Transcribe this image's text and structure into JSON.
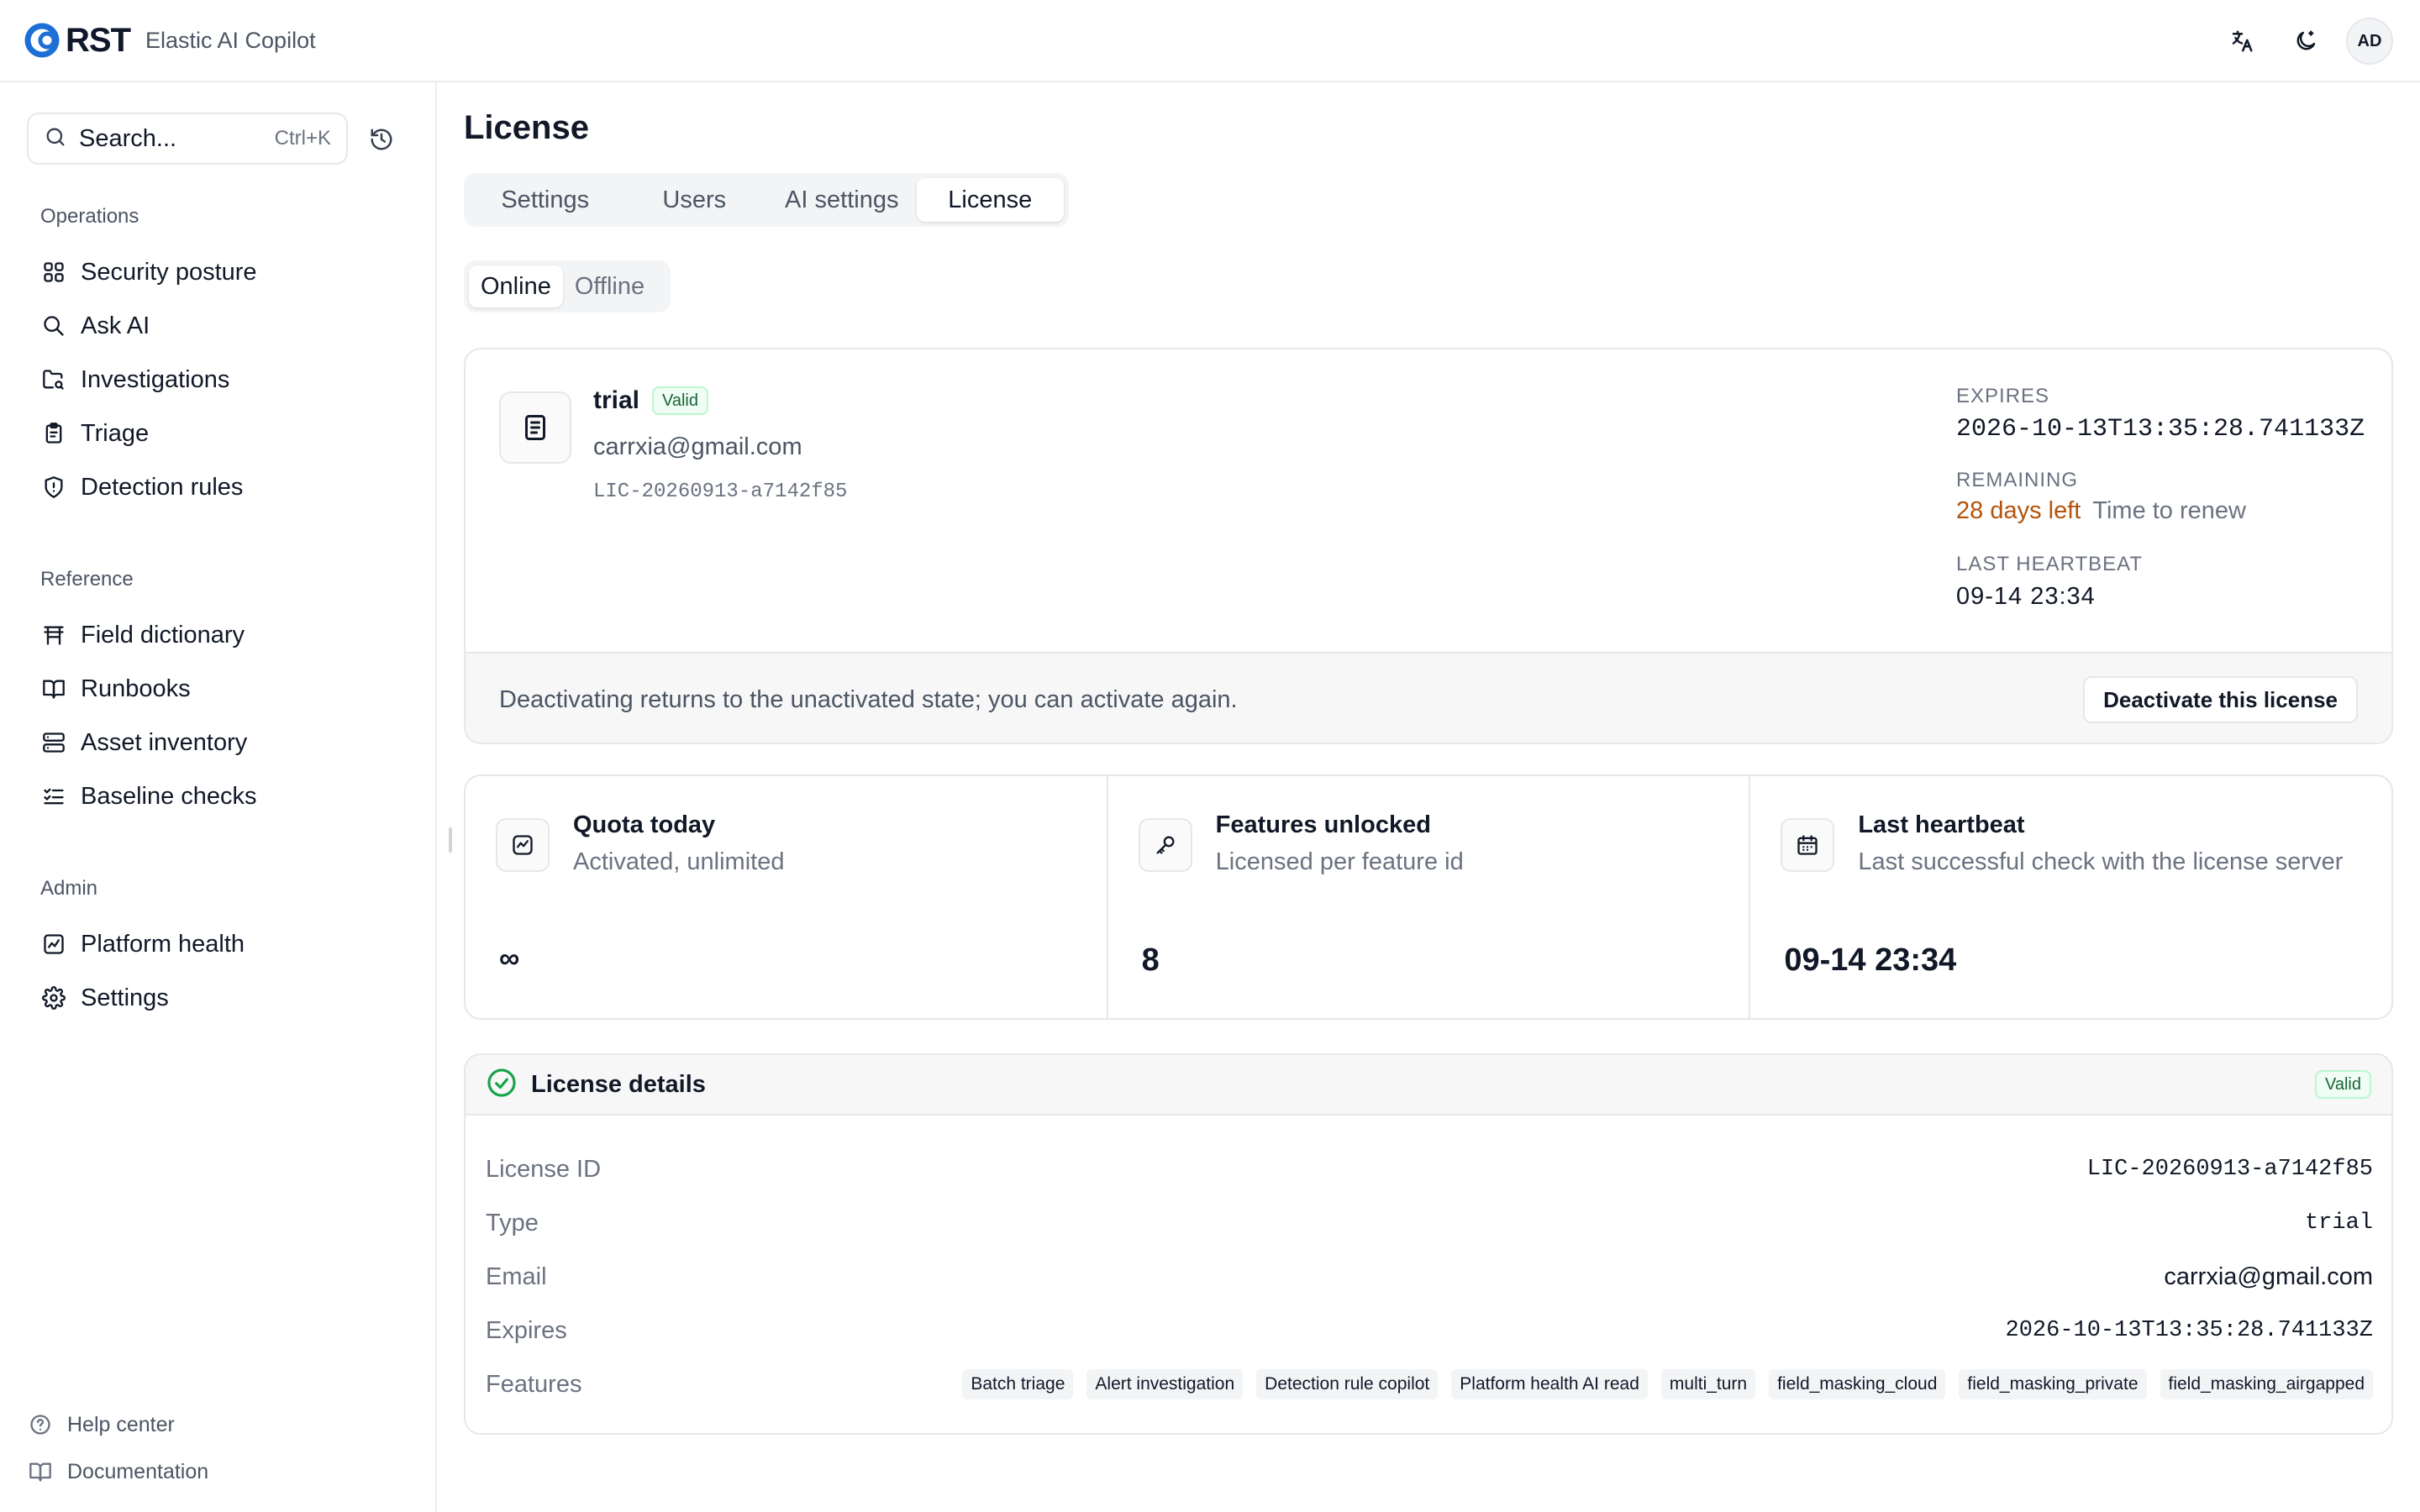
{
  "app": {
    "brand": "RST",
    "subtitle": "Elastic AI Copilot"
  },
  "header": {
    "avatar_initials": "AD",
    "icons": [
      "translate-icon",
      "theme-toggle-icon"
    ]
  },
  "sidebar": {
    "search": {
      "placeholder": "Search...",
      "shortcut": "Ctrl+K"
    },
    "sections": [
      {
        "label": "Operations",
        "items": [
          {
            "label": "Security posture",
            "icon": "grid-icon"
          },
          {
            "label": "Ask AI",
            "icon": "search-icon"
          },
          {
            "label": "Investigations",
            "icon": "folder-search-icon"
          },
          {
            "label": "Triage",
            "icon": "clipboard-icon"
          },
          {
            "label": "Detection rules",
            "icon": "shield-alert-icon"
          }
        ]
      },
      {
        "label": "Reference",
        "items": [
          {
            "label": "Field dictionary",
            "icon": "table-icon"
          },
          {
            "label": "Runbooks",
            "icon": "book-open-icon"
          },
          {
            "label": "Asset inventory",
            "icon": "server-icon"
          },
          {
            "label": "Baseline checks",
            "icon": "list-checks-icon"
          }
        ]
      },
      {
        "label": "Admin",
        "items": [
          {
            "label": "Platform health",
            "icon": "chart-icon"
          },
          {
            "label": "Settings",
            "icon": "gear-icon"
          }
        ]
      }
    ],
    "footer": [
      {
        "label": "Help center",
        "icon": "help-circle-icon"
      },
      {
        "label": "Documentation",
        "icon": "book-icon"
      }
    ]
  },
  "main": {
    "title": "License",
    "tabs": [
      {
        "label": "Settings",
        "active": false
      },
      {
        "label": "Users",
        "active": false
      },
      {
        "label": "AI settings",
        "active": false
      },
      {
        "label": "License",
        "active": true
      }
    ],
    "mode_tabs": [
      {
        "label": "Online",
        "active": true
      },
      {
        "label": "Offline",
        "active": false
      }
    ],
    "license": {
      "type": "trial",
      "status": "Valid",
      "email": "carrxia@gmail.com",
      "id": "LIC-20260913-a7142f85",
      "expires_label": "EXPIRES",
      "expires": "2026-10-13T13:35:28.741133Z",
      "remaining_label": "REMAINING",
      "remaining": "28 days left",
      "renew_hint": "Time to renew",
      "heartbeat_label": "LAST HEARTBEAT",
      "heartbeat": "09-14 23:34",
      "deactivate_note": "Deactivating returns to the unactivated state; you can activate again.",
      "deactivate_button": "Deactivate this license"
    },
    "stats": [
      {
        "title": "Quota today",
        "subtitle": "Activated, unlimited",
        "value": "∞",
        "icon": "activity-icon"
      },
      {
        "title": "Features unlocked",
        "subtitle": "Licensed per feature id",
        "value": "8",
        "icon": "key-icon"
      },
      {
        "title": "Last heartbeat",
        "subtitle": "Last successful check with the license server",
        "value": "09-14 23:34",
        "icon": "calendar-icon"
      }
    ],
    "details": {
      "title": "License details",
      "status": "Valid",
      "rows": [
        {
          "label": "License ID",
          "value": "LIC-20260913-a7142f85"
        },
        {
          "label": "Type",
          "value": "trial"
        },
        {
          "label": "Email",
          "value": "carrxia@gmail.com"
        },
        {
          "label": "Expires",
          "value": "2026-10-13T13:35:28.741133Z"
        }
      ],
      "features_label": "Features",
      "features": [
        "Batch triage",
        "Alert investigation",
        "Detection rule copilot",
        "Platform health AI read",
        "multi_turn",
        "field_masking_cloud",
        "field_masking_private",
        "field_masking_airgapped"
      ]
    }
  },
  "colors": {
    "brand_blue": "#1d6fd6",
    "warning_text": "#b45309",
    "valid_green": "#16a34a"
  }
}
